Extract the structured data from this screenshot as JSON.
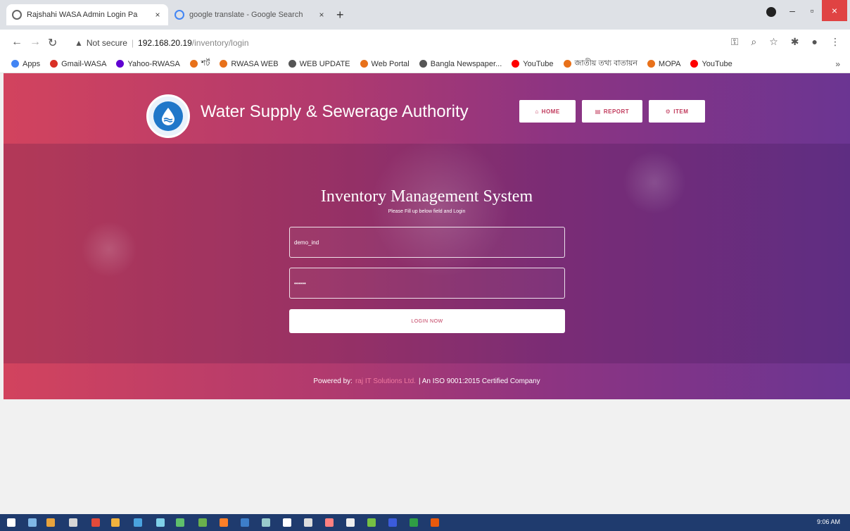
{
  "browser": {
    "tabs": [
      {
        "title": "Rajshahi WASA Admin Login Pa",
        "active": true
      },
      {
        "title": "google translate - Google Search",
        "active": false
      }
    ],
    "new_tab": "+",
    "address": {
      "security": "Not secure",
      "host": "192.168.20.19",
      "path": "/inventory/login"
    },
    "bookmarks": [
      {
        "label": "Apps",
        "color": "#4285f4"
      },
      {
        "label": "Gmail-WASA",
        "color": "#d93025"
      },
      {
        "label": "Yahoo-RWASA",
        "color": "#6001d2"
      },
      {
        "label": "শর্ট",
        "color": "#e8711a"
      },
      {
        "label": "RWASA WEB",
        "color": "#e8711a"
      },
      {
        "label": "WEB UPDATE",
        "color": "#555555"
      },
      {
        "label": "Web Portal",
        "color": "#e8711a"
      },
      {
        "label": "Bangla Newspaper...",
        "color": "#555555"
      },
      {
        "label": "YouTube",
        "color": "#ff0000"
      },
      {
        "label": "জাতীয় তথ্য বাতায়ন",
        "color": "#e8711a"
      },
      {
        "label": "MOPA",
        "color": "#e8711a"
      },
      {
        "label": "YouTube",
        "color": "#ff0000"
      }
    ]
  },
  "header": {
    "title": "Water Supply & Sewerage Authority",
    "nav": [
      "HOME",
      "REPORT",
      "ITEM"
    ]
  },
  "login": {
    "heading": "Inventory Management System",
    "subheading": "Please Fill up below field and Login",
    "username_value": "demo_ind",
    "password_value": "••••••",
    "button": "LOGIN NOW"
  },
  "footer": {
    "prefix": "Powered by:",
    "brand": "raj IT Solutions Ltd.",
    "suffix": "| An ISO 9001:2015 Certified Company"
  },
  "taskbar": {
    "time": "9:06 AM"
  },
  "colors": {
    "accent": "#c0395b",
    "gradient_start": "#d2435e",
    "gradient_end": "#6b3592"
  }
}
